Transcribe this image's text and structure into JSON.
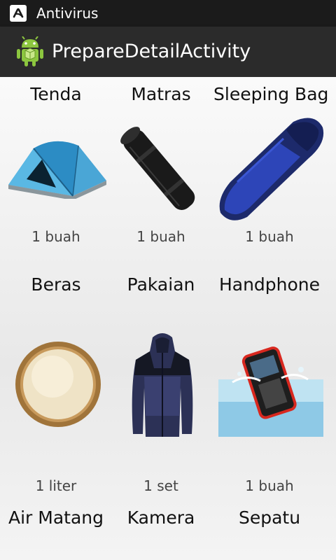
{
  "status_bar": {
    "app_name": "Antivirus"
  },
  "action_bar": {
    "title": "PrepareDetailActivity"
  },
  "items": [
    {
      "name": "Tenda",
      "qty": "1 buah",
      "icon": "tent-image"
    },
    {
      "name": "Matras",
      "qty": "1 buah",
      "icon": "sleeping-mat-image"
    },
    {
      "name": "Sleeping Bag",
      "qty": "1 buah",
      "icon": "sleeping-bag-image"
    },
    {
      "name": "Beras",
      "qty": "1 liter",
      "icon": "rice-image"
    },
    {
      "name": "Pakaian",
      "qty": "1 set",
      "icon": "jacket-image"
    },
    {
      "name": "Handphone",
      "qty": "1 buah",
      "icon": "phone-image"
    },
    {
      "name": "Air Matang",
      "qty": "",
      "icon": "water-image"
    },
    {
      "name": "Kamera",
      "qty": "",
      "icon": "camera-image"
    },
    {
      "name": "Sepatu",
      "qty": "",
      "icon": "shoes-image"
    }
  ]
}
